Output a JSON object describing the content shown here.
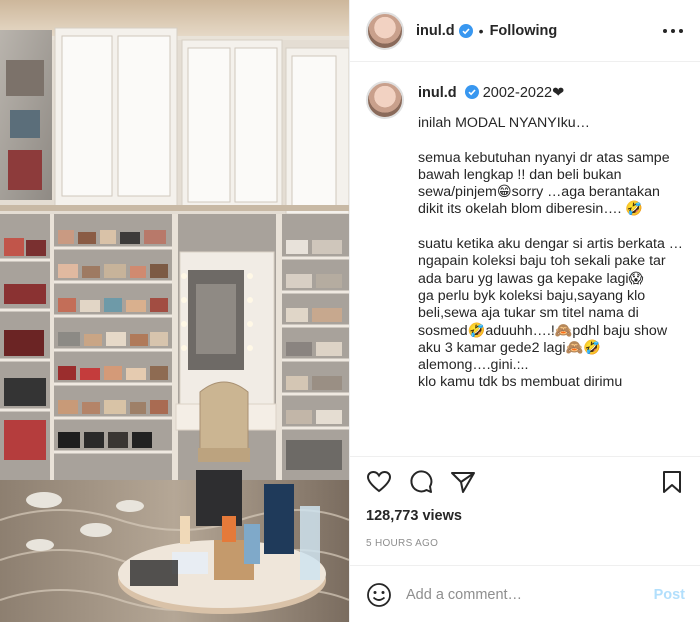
{
  "colors": {
    "accent": "#0095f6",
    "post_disabled": "#b2dffc",
    "verified": "#3897f0",
    "muted": "#8e8e8e",
    "border": "#efefef"
  },
  "header": {
    "username": "inul.d",
    "separator": "•",
    "follow_label": "Following",
    "more_icon": "more-horizontal-icon"
  },
  "caption": {
    "username": "inul.d",
    "headline": "2002-2022❤",
    "text": "inilah MODAL NYANYIku…\n\nsemua kebutuhan nyanyi dr atas sampe bawah lengkap !! dan beli bukan sewa/pinjem😁sorry …aga berantakan dikit its okelah blom diberesin…. 🤣\n\nsuatu ketika aku dengar si artis berkata …\nngapain koleksi baju toh sekali pake tar ada baru yg lawas ga kepake lagi😱\nga perlu byk koleksi baju,sayang klo beli,sewa aja tukar sm titel nama di sosmed🤣aduuhh….!🙈pdhl baju show aku 3 kamar gede2 lagi🙈🤣 alemong….gini.:..\nklo kamu tdk bs membuat dirimu"
  },
  "actions": {
    "icons": [
      "heart-icon",
      "comment-icon",
      "share-icon",
      "save-icon"
    ],
    "views": "128,773 views",
    "time": "5 HOURS AGO"
  },
  "comment": {
    "placeholder": "Add a comment…",
    "post_label": "Post",
    "emoji_icon": "emoji-icon"
  }
}
